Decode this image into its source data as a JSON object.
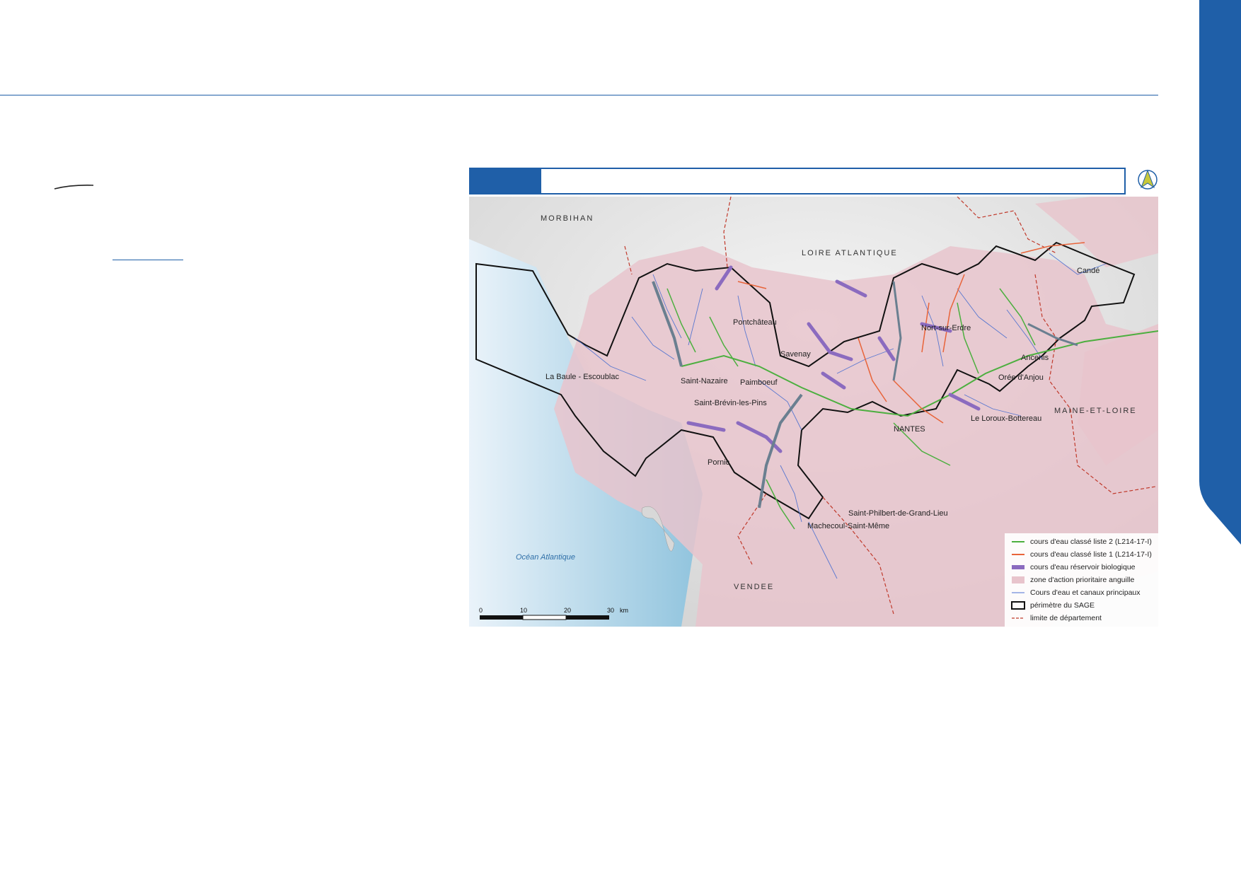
{
  "colors": {
    "accent": "#1f5fa8",
    "eel_zone": "#e8c4cc",
    "list2": "#4caf3f",
    "list1": "#e8643a",
    "reservoir": "#8b6bbf",
    "streams": "#4a6fd0",
    "dept_limit": "#c0392b"
  },
  "map": {
    "departments": [
      "MORBIHAN",
      "LOIRE ATLANTIQUE",
      "MAINE-ET-LOIRE",
      "VENDEE"
    ],
    "sea_label": "Océan Atlantique",
    "towns": [
      "Candé",
      "Nort-sur-Erdre",
      "Ancenis",
      "Orée d'Anjou",
      "Pontchâteau",
      "Savenay",
      "La Baule - Escoublac",
      "Saint-Nazaire",
      "Paimboeuf",
      "Saint-Brévin-les-Pins",
      "NANTES",
      "Le Loroux-Bottereau",
      "Pornic",
      "Saint-Philbert-de-Grand-Lieu",
      "Machecoul-Saint-Même"
    ]
  },
  "legend": [
    {
      "label": "cours d'eau classé liste 2 (L214-17-I)",
      "icon": "green-line"
    },
    {
      "label": "cours d'eau classé liste 1 (L214-17-I)",
      "icon": "orange-line"
    },
    {
      "label": "cours d'eau réservoir biologique",
      "icon": "purple-band"
    },
    {
      "label": "zone d'action prioritaire anguille",
      "icon": "pink-fill"
    },
    {
      "label": "Cours d'eau et canaux principaux",
      "icon": "blue-line"
    },
    {
      "label": "périmètre du SAGE",
      "icon": "black-box"
    },
    {
      "label": "limite de département",
      "icon": "red-dash"
    }
  ],
  "scale": {
    "ticks": [
      "0",
      "10",
      "20",
      "30"
    ],
    "unit": "km"
  }
}
